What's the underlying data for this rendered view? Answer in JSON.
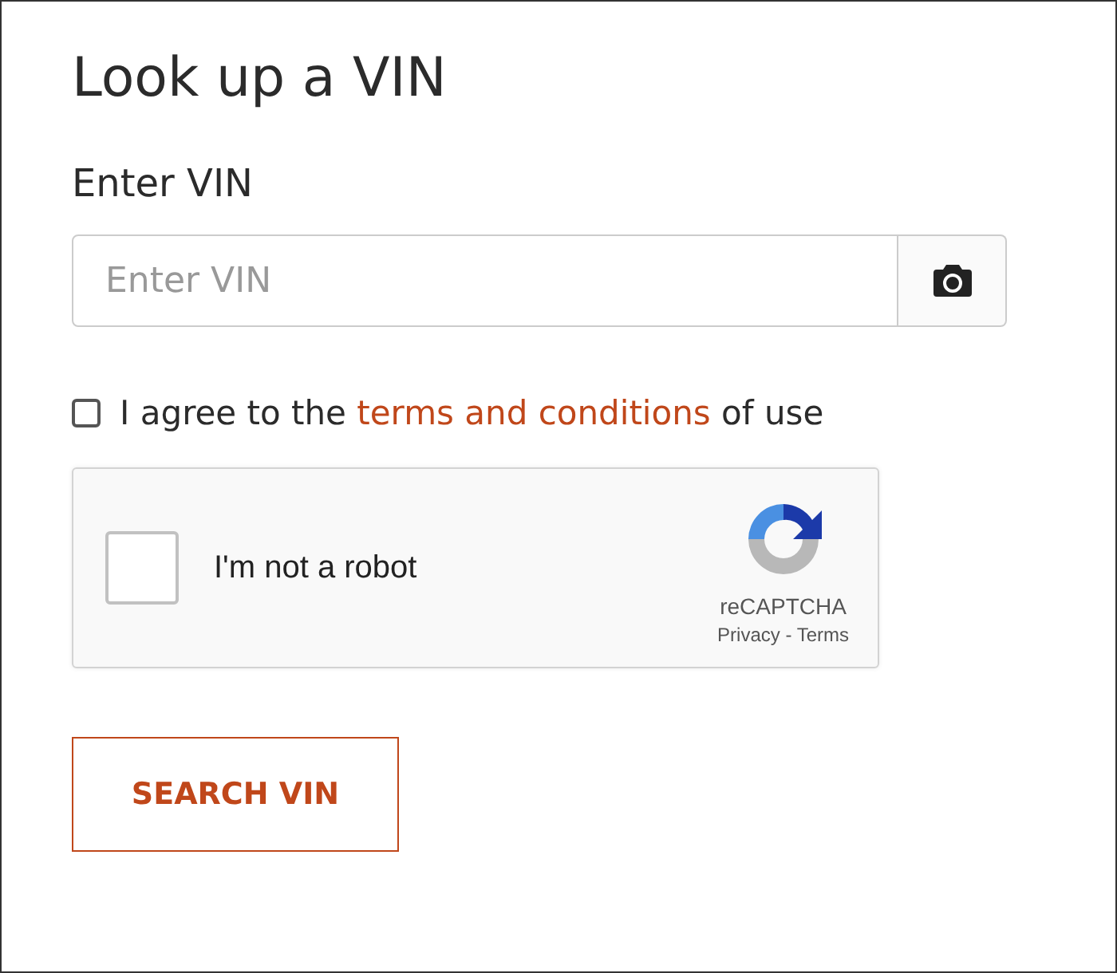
{
  "title": "Look up a VIN",
  "vin_field": {
    "label": "Enter VIN",
    "placeholder": "Enter VIN"
  },
  "agreement": {
    "checked": false,
    "before": "I agree to the ",
    "link": "terms and conditions",
    "after": " of use"
  },
  "recaptcha": {
    "checked": false,
    "label": "I'm not a robot",
    "brand": "reCAPTCHA",
    "privacy": "Privacy",
    "separator": " - ",
    "terms": "Terms"
  },
  "submit_button": "SEARCH VIN"
}
